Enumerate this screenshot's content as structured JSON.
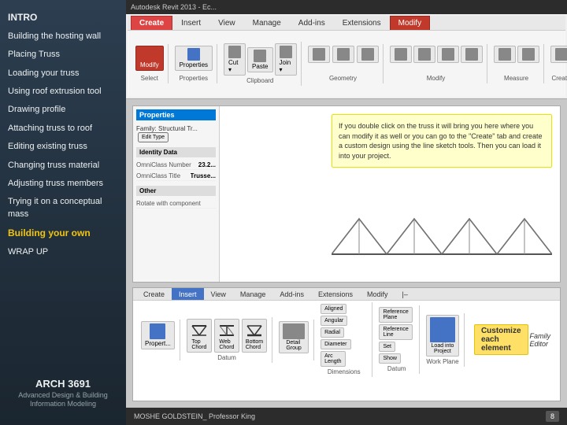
{
  "app": {
    "title": "Autodesk Revit 2013 - Ec...",
    "ribbon_tabs": [
      "Create",
      "Insert",
      "View",
      "Manage",
      "Add-ins",
      "Extensions",
      "Modify"
    ],
    "active_tab": "Modify"
  },
  "sidebar": {
    "items": [
      {
        "label": "INTRO",
        "type": "header"
      },
      {
        "label": "Building the hosting wall",
        "type": "normal"
      },
      {
        "label": "Placing Truss",
        "type": "normal"
      },
      {
        "label": "Loading your truss",
        "type": "normal"
      },
      {
        "label": "Using roof extrusion tool",
        "type": "normal"
      },
      {
        "label": "Drawing profile",
        "type": "normal"
      },
      {
        "label": "Attaching truss to roof",
        "type": "normal"
      },
      {
        "label": "Editing existing truss",
        "type": "normal"
      },
      {
        "label": "Changing truss material",
        "type": "normal"
      },
      {
        "label": "Adjusting truss members",
        "type": "normal"
      },
      {
        "label": "Trying it on a conceptual mass",
        "type": "normal"
      },
      {
        "label": "Building your own",
        "type": "highlighted"
      },
      {
        "label": "WRAP UP",
        "type": "normal"
      }
    ],
    "bottom": {
      "arch_title": "ARCH 3691",
      "arch_subtitle": "Advanced Design & Building Information Modeling"
    }
  },
  "slide_top": {
    "info_text": "If you double click on the truss it will bring you here where you can modify it as well or you can go to the \"Create\" tab and create a custom design using the line sketch tools. Then you can load it into your project.",
    "properties": {
      "header": "Properties",
      "family_label": "Family: Structural Tr...",
      "edit_type": "Edit Type",
      "identity_header": "Identity Data",
      "omni_class_number_label": "OmniClass Number",
      "omni_class_number_value": "23.2...",
      "omni_class_title_label": "OmniClass Title",
      "omni_class_title_value": "Trusse...",
      "other_header": "Other",
      "rotate_label": "Rotate with component"
    }
  },
  "slide_bottom": {
    "tabs": [
      "Create",
      "Insert",
      "View",
      "Manage",
      "Add-ins",
      "Extensions",
      "Modify",
      "|-"
    ],
    "active_tab": "Insert",
    "tool_groups": [
      {
        "label": "Properties",
        "buttons": [
          "Propert..."
        ]
      },
      {
        "label": "Datum",
        "buttons": [
          "Top Chord",
          "Web Chord",
          "Bottom Chord"
        ]
      },
      {
        "label": "Dimensions",
        "buttons": [
          "Detail Group",
          "Aligned",
          "Angular",
          "Radial",
          "Diameter",
          "Arc Length"
        ]
      },
      {
        "label": "Datum",
        "buttons": [
          "Reference Plane",
          "Reference Line",
          "Set",
          "Show"
        ]
      },
      {
        "label": "Work Plane",
        "buttons": [
          "Load into Project"
        ]
      },
      {
        "label": "Family Editor",
        "buttons": []
      }
    ],
    "highlight_text": "Customize each element"
  },
  "footer": {
    "name": "MOSHE GOLDSTEIN_ Professor King",
    "page": "8"
  }
}
